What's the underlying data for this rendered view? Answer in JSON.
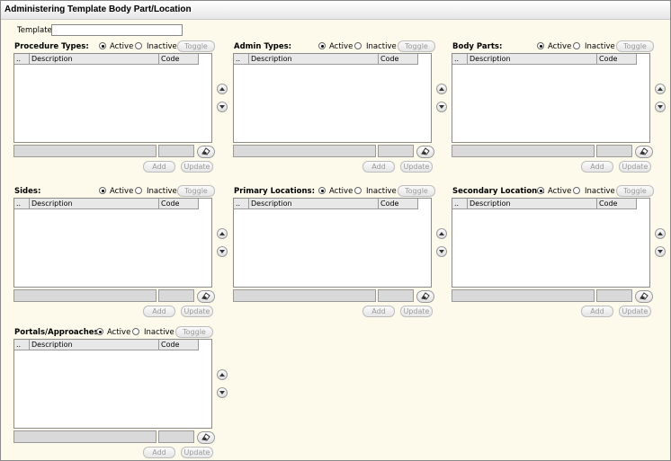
{
  "window": {
    "title": "Administering Template Body Part/Location"
  },
  "template": {
    "label": "Template:",
    "value": ""
  },
  "common": {
    "active_label": "Active",
    "inactive_label": "Inactive",
    "toggle_label": "Toggle",
    "add_label": "Add",
    "update_label": "Update",
    "col_marker": "..",
    "col_description": "Description",
    "col_code": "Code"
  },
  "sections": [
    {
      "title": "Procedure Types:"
    },
    {
      "title": "Admin Types:"
    },
    {
      "title": "Body Parts:"
    },
    {
      "title": "Sides:"
    },
    {
      "title": "Primary Locations:"
    },
    {
      "title": "Secondary Locations:"
    },
    {
      "title": "Portals/Approaches:"
    }
  ],
  "icons": {
    "eraser": "eraser-icon",
    "up": "up-arrow-icon",
    "down": "down-arrow-icon"
  }
}
